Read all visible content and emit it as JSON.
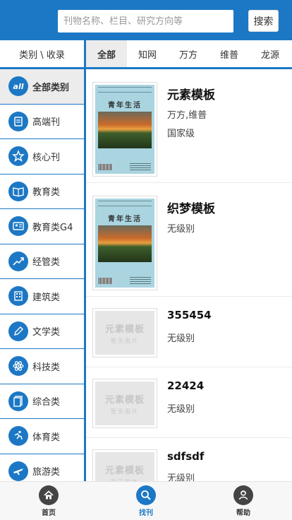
{
  "search": {
    "placeholder": "刊物名称、栏目、研究方向等",
    "button_label": "搜索"
  },
  "category_header": "类别 \\ 收录",
  "tabs": [
    {
      "label": "全部",
      "active": true
    },
    {
      "label": "知网",
      "active": false
    },
    {
      "label": "万方",
      "active": false
    },
    {
      "label": "维普",
      "active": false
    },
    {
      "label": "龙源",
      "active": false
    }
  ],
  "sidebar": {
    "all_icon_text": "all",
    "items": [
      {
        "label": "全部类别",
        "icon": "all-icon"
      },
      {
        "label": "高端刊",
        "icon": "magazine-icon"
      },
      {
        "label": "核心刊",
        "icon": "star-icon"
      },
      {
        "label": "教育类",
        "icon": "book-icon"
      },
      {
        "label": "教育类G4",
        "icon": "reader-icon"
      },
      {
        "label": "经管类",
        "icon": "chart-icon"
      },
      {
        "label": "建筑类",
        "icon": "building-icon"
      },
      {
        "label": "文学类",
        "icon": "pen-icon"
      },
      {
        "label": "科技类",
        "icon": "atom-icon"
      },
      {
        "label": "综合类",
        "icon": "document-icon"
      },
      {
        "label": "体育类",
        "icon": "runner-icon"
      },
      {
        "label": "旅游类",
        "icon": "plane-icon"
      }
    ]
  },
  "cover": {
    "title": "青年生活"
  },
  "placeholder": {
    "main": "元素模板",
    "sub": "暂无图片"
  },
  "items": [
    {
      "title": "元素模板",
      "meta": [
        "万方,维普",
        "国家级"
      ],
      "has_cover": true
    },
    {
      "title": "织梦模板",
      "meta": [
        "无级别"
      ],
      "has_cover": true
    },
    {
      "title": "355454",
      "meta": [
        "无级别"
      ],
      "has_cover": false
    },
    {
      "title": "22424",
      "meta": [
        "无级别"
      ],
      "has_cover": false
    },
    {
      "title": "sdfsdf",
      "meta": [
        "无级别"
      ],
      "has_cover": false
    }
  ],
  "bottom_nav": [
    {
      "label": "首页",
      "icon": "home-icon",
      "active": false
    },
    {
      "label": "找刊",
      "icon": "search-icon",
      "active": true
    },
    {
      "label": "帮助",
      "icon": "help-icon",
      "active": false
    }
  ],
  "colors": {
    "brand": "#1c78c5",
    "active_bg": "#ececec"
  }
}
